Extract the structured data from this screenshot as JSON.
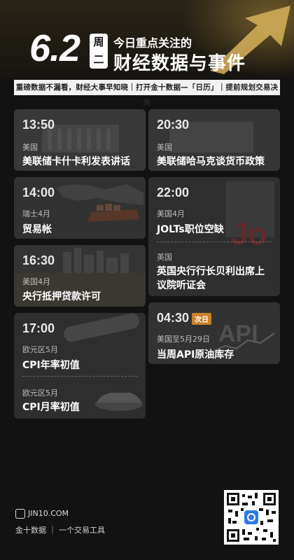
{
  "header": {
    "date": "6.2",
    "weekday_top": "周",
    "weekday_bottom": "二",
    "subtitle": "今日重点关注的",
    "title": "财经数据与事件",
    "tagline": "重磅数据不漏看，财经大事早知晓｜打开金十数据—「日历」｜提前规划交易决策"
  },
  "events": [
    {
      "time": "13:50",
      "region": "美国",
      "title": "美联储卡什卡利发表讲话"
    },
    {
      "time": "20:30",
      "region": "美国",
      "title": "美联储哈马克谈货币政策"
    },
    {
      "time": "14:00",
      "region": "瑞士4月",
      "title": "贸易帐"
    },
    {
      "time": "22:00",
      "region": "美国4月",
      "title": "JOLTs职位空缺"
    },
    {
      "time": "",
      "region": "英国",
      "title_line1": "英国央行行长贝利出席上",
      "title_line2": "议院听证会"
    },
    {
      "time": "16:30",
      "region": "美国4月",
      "title": "央行抵押贷款许可"
    },
    {
      "time": "17:00",
      "region": "欧元区5月",
      "title": "CPI年率初值"
    },
    {
      "time": "",
      "region": "欧元区5月",
      "title": "CPI月率初值"
    },
    {
      "time": "04:30",
      "badge": "次日",
      "region": "美国至5月29日",
      "title": "当周API原油库存"
    }
  ],
  "footer": {
    "site": "JIN10.COM",
    "brand": "金十数据 ｜ 一个交易工具"
  },
  "colors": {
    "background": "#121212",
    "card": "#2d2d2d",
    "badge": "#c9822a",
    "accent": "#c9a04a"
  }
}
